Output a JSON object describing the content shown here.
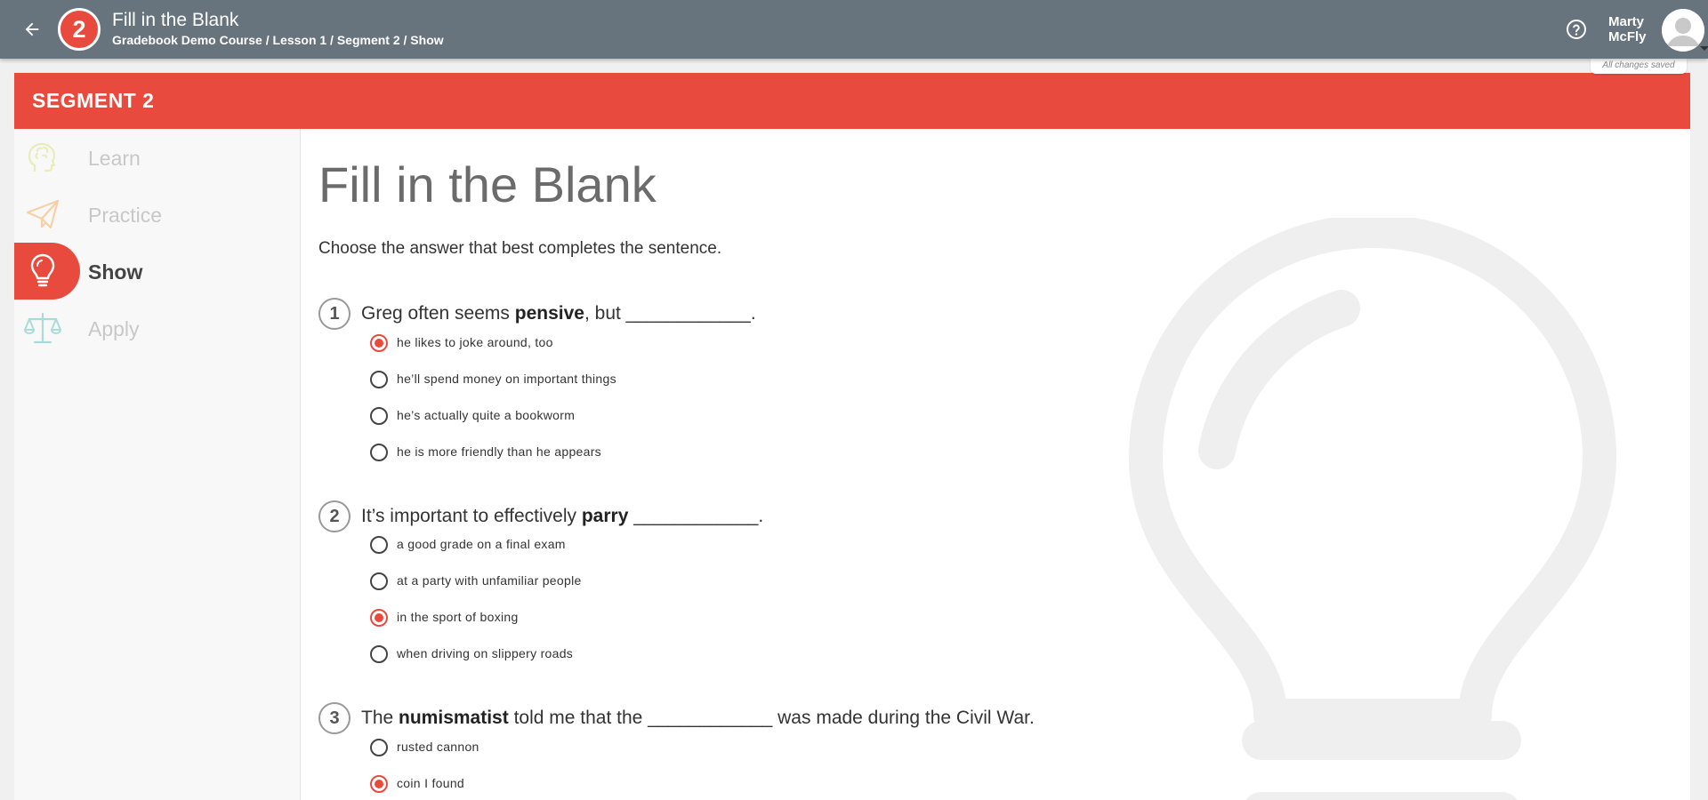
{
  "topbar": {
    "segment_number": "2",
    "title": "Fill in the Blank",
    "breadcrumb": "Gradebook Demo Course / Lesson 1 / Segment 2 / Show",
    "user_first": "Marty",
    "user_last": "McFly",
    "saved_status": "All changes saved"
  },
  "segment": {
    "title": "SEGMENT 2"
  },
  "sidebar": {
    "items": [
      {
        "label": "Learn",
        "icon": "brain-icon",
        "active": false
      },
      {
        "label": "Practice",
        "icon": "paper-plane-icon",
        "active": false
      },
      {
        "label": "Show",
        "icon": "lightbulb-icon",
        "active": true
      },
      {
        "label": "Apply",
        "icon": "scales-icon",
        "active": false
      }
    ]
  },
  "main": {
    "title": "Fill in the Blank",
    "instructions": "Choose the answer that best completes the sentence.",
    "questions": [
      {
        "number": "1",
        "before": "Greg often seems ",
        "bold": "pensive",
        "after": ", but ____________.",
        "options": [
          {
            "label": "he likes to joke around, too",
            "selected": true
          },
          {
            "label": "he’ll spend money on important things",
            "selected": false
          },
          {
            "label": "he’s actually quite a bookworm",
            "selected": false
          },
          {
            "label": "he is more friendly than he appears",
            "selected": false
          }
        ]
      },
      {
        "number": "2",
        "before": "It’s important to effectively ",
        "bold": "parry",
        "after": " ____________.",
        "options": [
          {
            "label": "a good grade on a final exam",
            "selected": false
          },
          {
            "label": "at a party with unfamiliar people",
            "selected": false
          },
          {
            "label": "in the sport of boxing",
            "selected": true
          },
          {
            "label": "when driving on slippery roads",
            "selected": false
          }
        ]
      },
      {
        "number": "3",
        "before": "The ",
        "bold": "numismatist",
        "after": " told me that the ____________ was made during the Civil War.",
        "options": [
          {
            "label": "rusted cannon",
            "selected": false
          },
          {
            "label": "coin I found",
            "selected": true
          }
        ]
      }
    ]
  },
  "colors": {
    "accent": "#e84b3d",
    "topbar": "#67737d"
  }
}
